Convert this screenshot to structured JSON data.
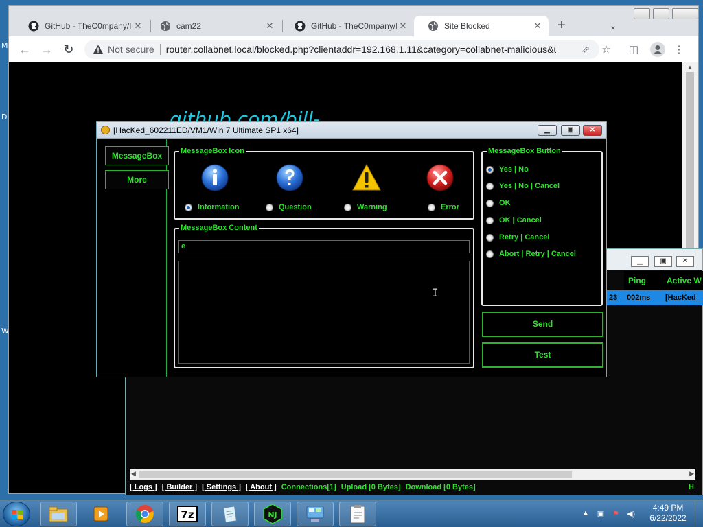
{
  "desktop": {
    "edge_letters": [
      "M",
      "D",
      "W"
    ]
  },
  "chrome": {
    "tabs": [
      {
        "title": "GitHub - TheC0mpany/I",
        "favicon": "github-icon",
        "active": false
      },
      {
        "title": "cam22",
        "favicon": "globe-icon",
        "active": false
      },
      {
        "title": "GitHub - TheC0mpany/I",
        "favicon": "github-icon",
        "active": false
      },
      {
        "title": "Site Blocked",
        "favicon": "globe-icon",
        "active": true
      }
    ],
    "new_tab_label": "+",
    "omnibox": {
      "security_label": "Not secure",
      "url": "router.collabnet.local/blocked.php?clientaddr=192.168.1.11&category=collabnet-malicious&u..."
    },
    "page": {
      "heading": "github.com/bill-"
    }
  },
  "client_window": {
    "columns": [
      "Ping",
      "Active W"
    ],
    "rows": [
      {
        "partial": "23",
        "ping": "002ms",
        "active_window": "[HacKed_"
      }
    ],
    "status": {
      "links": [
        "[ Logs ]",
        "[ Builder ]",
        "[ Settings ]",
        "[ About ]"
      ],
      "connections": "Connections[1]",
      "upload": "Upload [0 Bytes]",
      "download": "Download [0 Bytes]",
      "trailing": "H"
    }
  },
  "dialog": {
    "title": "[HacKed_602211ED/VM1/Win 7 Ultimate SP1 x64]",
    "sidebar": [
      "MessageBox",
      "More"
    ],
    "icon_group": {
      "label": "MessageBox Icon",
      "options": [
        {
          "label": "Information",
          "icon": "information-icon",
          "selected": true
        },
        {
          "label": "Question",
          "icon": "question-icon",
          "selected": false
        },
        {
          "label": "Warning",
          "icon": "warning-icon",
          "selected": false
        },
        {
          "label": "Error",
          "icon": "error-icon",
          "selected": false
        }
      ]
    },
    "content_group": {
      "label": "MessageBox Content",
      "title_value": "e",
      "body_value": ""
    },
    "button_group": {
      "label": "MessageBox Button",
      "options": [
        {
          "label": "Yes | No",
          "selected": true
        },
        {
          "label": "Yes | No | Cancel",
          "selected": false
        },
        {
          "label": "OK",
          "selected": false
        },
        {
          "label": "OK | Cancel",
          "selected": false
        },
        {
          "label": "Retry | Cancel",
          "selected": false
        },
        {
          "label": "Abort | Retry | Cancel",
          "selected": false
        }
      ]
    },
    "actions": {
      "send": "Send",
      "test": "Test"
    }
  },
  "taskbar": {
    "apps": [
      "explorer-icon",
      "media-player-icon",
      "chrome-icon",
      "7zip-icon",
      "notepad-icon",
      "njrat-icon",
      "control-panel-icon",
      "clipboard-icon"
    ],
    "clock": {
      "time": "4:49 PM",
      "date": "6/22/2022"
    }
  },
  "colors": {
    "accent_green": "#2fe02f",
    "page_heading": "#1ec8e0",
    "row_select": "#1e88e5"
  }
}
